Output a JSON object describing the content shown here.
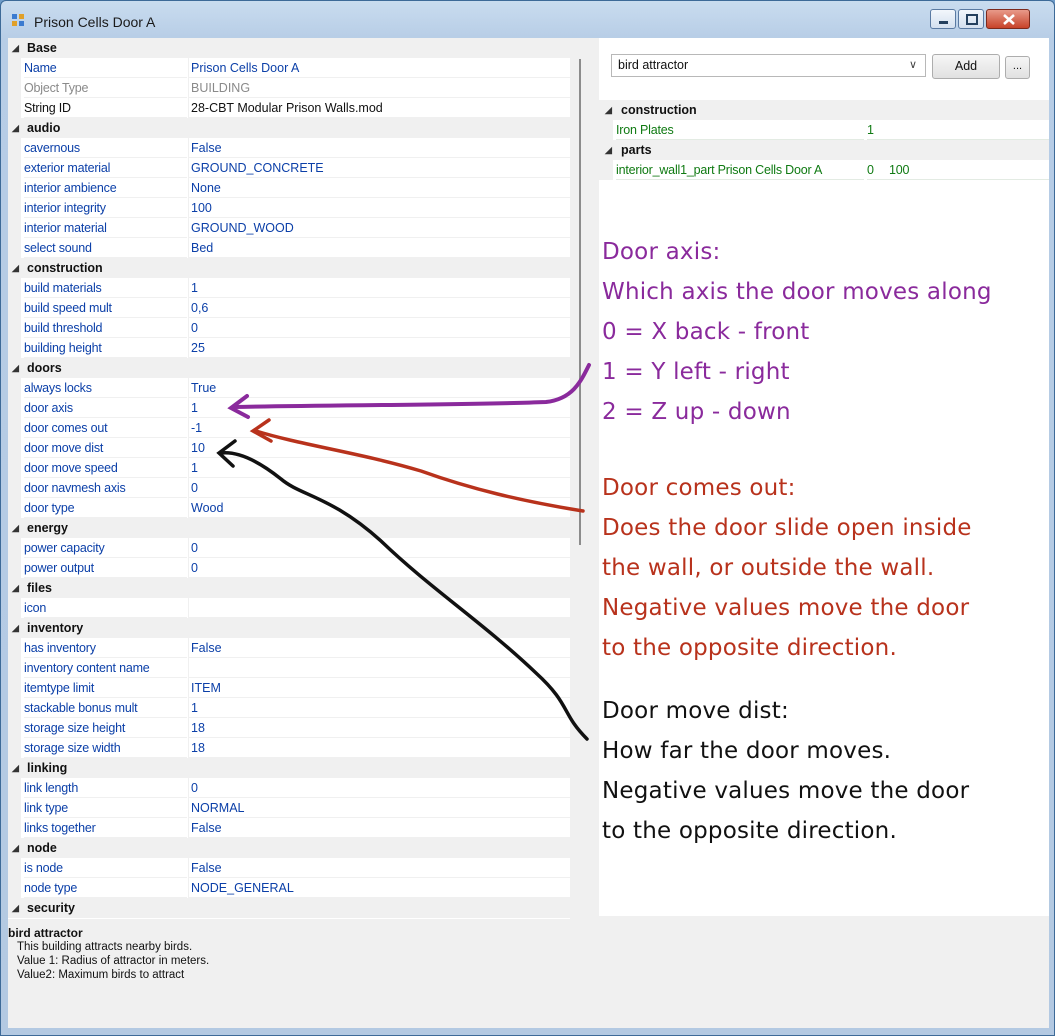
{
  "window": {
    "title": "Prison Cells Door A"
  },
  "grid": {
    "rows": [
      {
        "type": "cat",
        "label": "Base"
      },
      {
        "type": "prop",
        "name": "Name",
        "value": "Prison Cells Door A"
      },
      {
        "type": "prop",
        "name": "Object Type",
        "value": "BUILDING",
        "style": "gray"
      },
      {
        "type": "prop",
        "name": "String ID",
        "value": "28-CBT Modular Prison Walls.mod",
        "style": "black"
      },
      {
        "type": "cat",
        "label": "audio"
      },
      {
        "type": "prop",
        "name": "cavernous",
        "value": "False"
      },
      {
        "type": "prop",
        "name": "exterior material",
        "value": "GROUND_CONCRETE"
      },
      {
        "type": "prop",
        "name": "interior ambience",
        "value": "None"
      },
      {
        "type": "prop",
        "name": "interior integrity",
        "value": "100"
      },
      {
        "type": "prop",
        "name": "interior material",
        "value": "GROUND_WOOD"
      },
      {
        "type": "prop",
        "name": "select sound",
        "value": "Bed"
      },
      {
        "type": "cat",
        "label": "construction"
      },
      {
        "type": "prop",
        "name": "build materials",
        "value": "1"
      },
      {
        "type": "prop",
        "name": "build speed mult",
        "value": "0,6"
      },
      {
        "type": "prop",
        "name": "build threshold",
        "value": "0"
      },
      {
        "type": "prop",
        "name": "building height",
        "value": "25"
      },
      {
        "type": "cat",
        "label": "doors"
      },
      {
        "type": "prop",
        "name": "always locks",
        "value": "True"
      },
      {
        "type": "prop",
        "name": "door axis",
        "value": "1"
      },
      {
        "type": "prop",
        "name": "door comes out",
        "value": "-1"
      },
      {
        "type": "prop",
        "name": "door move dist",
        "value": "10"
      },
      {
        "type": "prop",
        "name": "door move speed",
        "value": "1"
      },
      {
        "type": "prop",
        "name": "door navmesh axis",
        "value": "0"
      },
      {
        "type": "prop",
        "name": "door type",
        "value": "Wood"
      },
      {
        "type": "cat",
        "label": "energy"
      },
      {
        "type": "prop",
        "name": "power capacity",
        "value": "0"
      },
      {
        "type": "prop",
        "name": "power output",
        "value": "0"
      },
      {
        "type": "cat",
        "label": "files"
      },
      {
        "type": "prop",
        "name": "icon",
        "value": ""
      },
      {
        "type": "cat",
        "label": "inventory"
      },
      {
        "type": "prop",
        "name": "has inventory",
        "value": "False"
      },
      {
        "type": "prop",
        "name": "inventory content name",
        "value": ""
      },
      {
        "type": "prop",
        "name": "itemtype limit",
        "value": "ITEM"
      },
      {
        "type": "prop",
        "name": "stackable bonus mult",
        "value": "1"
      },
      {
        "type": "prop",
        "name": "storage size height",
        "value": "18"
      },
      {
        "type": "prop",
        "name": "storage size width",
        "value": "18"
      },
      {
        "type": "cat",
        "label": "linking"
      },
      {
        "type": "prop",
        "name": "link length",
        "value": "0"
      },
      {
        "type": "prop",
        "name": "link type",
        "value": "NORMAL"
      },
      {
        "type": "prop",
        "name": "links together",
        "value": "False"
      },
      {
        "type": "cat",
        "label": "node"
      },
      {
        "type": "prop",
        "name": "is node",
        "value": "False"
      },
      {
        "type": "prop",
        "name": "node type",
        "value": "NODE_GENERAL"
      },
      {
        "type": "cat",
        "label": "security"
      }
    ]
  },
  "description": {
    "title": "bird attractor",
    "lines": [
      "This building attracts nearby birds.",
      "Value 1: Radius of attractor in meters.",
      "Value2: Maximum birds to attract"
    ]
  },
  "right_panel": {
    "combo_value": "bird attractor",
    "add_label": "Add",
    "more_label": "...",
    "sections": [
      {
        "label": "construction",
        "items": [
          {
            "name": "Iron Plates",
            "v1": "1",
            "v2": ""
          }
        ]
      },
      {
        "label": "parts",
        "items": [
          {
            "name": "interior_wall1_part Prison Cells Door A",
            "v1": "0",
            "v2": "100"
          }
        ]
      }
    ]
  },
  "annotations": {
    "door_axis": [
      "Door axis:",
      "Which axis the door moves along",
      "0 = X  back - front",
      "1 = Y  left - right",
      "2 = Z  up - down"
    ],
    "door_comes_out": [
      "Door comes out:",
      "Does the door slide open inside",
      "the wall, or outside the wall.",
      "Negative values move the door",
      "to the opposite direction."
    ],
    "door_move_dist": [
      "Door move dist:",
      "How far the door moves.",
      "Negative values move the door",
      "to the opposite direction."
    ]
  },
  "colors": {
    "property_text": "#0b3fa8",
    "list_text": "#0f7a12",
    "annot_purple": "#8a2a9c",
    "annot_red": "#b8321c",
    "annot_black": "#111111",
    "title_bar": "#b7cde6"
  }
}
